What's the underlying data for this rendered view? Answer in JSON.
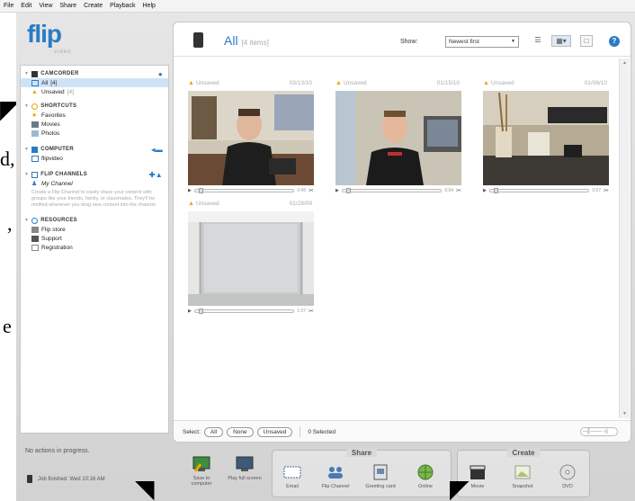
{
  "menu": [
    "File",
    "Edit",
    "View",
    "Share",
    "Create",
    "Playback",
    "Help"
  ],
  "logo": {
    "text": "flip",
    "sub": "video"
  },
  "sidebar": {
    "camcorder": {
      "title": "CAMCORDER",
      "items": [
        {
          "label": "All",
          "count": "[4]"
        },
        {
          "label": "Unsaved",
          "count": "[4]"
        }
      ]
    },
    "shortcuts": {
      "title": "SHORTCUTS",
      "items": [
        "Favorites",
        "Movies",
        "Photos"
      ]
    },
    "computer": {
      "title": "COMPUTER",
      "items": [
        "flipvideo"
      ]
    },
    "flip_channels": {
      "title": "FLIP CHANNELS",
      "items": [
        "My Channel"
      ],
      "description": "Create a Flip Channel to easily share your content with groups like your friends, family, or classmates. They'll be notified whenever you drag new content into the channel."
    },
    "resources": {
      "title": "RESOURCES",
      "items": [
        "Flip store",
        "Support",
        "Registration"
      ]
    }
  },
  "content": {
    "title": "All",
    "count": "[4 items]",
    "show_label": "Show:",
    "show_value": "Newest first",
    "clips": [
      {
        "status": "Unsaved",
        "date": "03/13/10",
        "duration": "0:45"
      },
      {
        "status": "Unsaved",
        "date": "01/15/10",
        "duration": "0:04"
      },
      {
        "status": "Unsaved",
        "date": "01/06/10",
        "duration": "0:07"
      },
      {
        "status": "Unsaved",
        "date": "01/28/09",
        "duration": "1:07"
      }
    ],
    "select_label": "Select:",
    "select_all": "All",
    "select_none": "None",
    "select_unsaved": "Unsaved",
    "selected_count": "0 Selected"
  },
  "bottom": {
    "status": "No actions in progress.",
    "job": "Job finished: Wed 10:16 AM",
    "save": "Save to computer",
    "play": "Play full screen",
    "share_title": "Share",
    "share_items": [
      "Email",
      "Flip Channel",
      "Greeting card",
      "Online"
    ],
    "create_title": "Create",
    "create_items": [
      "Movie",
      "Snapshot",
      "DVD"
    ]
  },
  "text_fragments": [
    "d,",
    ",",
    "e"
  ],
  "colors": {
    "accent": "#2b7bc5",
    "warning": "#e9a800",
    "selection": "#cfe3f6"
  }
}
